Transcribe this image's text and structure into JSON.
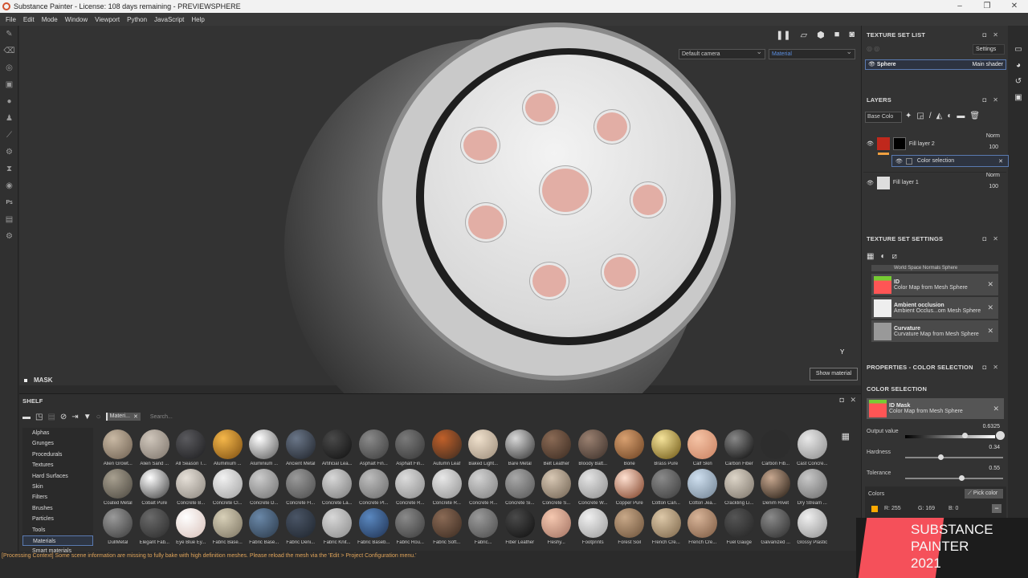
{
  "window": {
    "title": "Substance Painter - License: 108 days remaining - PREVIEWSPHERE",
    "controls": [
      "–",
      "❐",
      "✕"
    ]
  },
  "menu": [
    "File",
    "Edit",
    "Mode",
    "Window",
    "Viewport",
    "Python",
    "JavaScript",
    "Help"
  ],
  "left_tools": [
    "paint-brush",
    "eraser",
    "projection",
    "geometry-decal",
    "smudge",
    "clone-stamp",
    "color-picker",
    "settings",
    "bake",
    "material",
    "photoshop-export",
    "export",
    "plugin"
  ],
  "viewport": {
    "camera_select": "Default camera",
    "mode_select": "Material",
    "show_material_label": "Show material",
    "axis_label": "Y",
    "mask_label": "MASK"
  },
  "shelf": {
    "title": "SHELF",
    "filter_chip": "Materi...",
    "search_placeholder": "Search...",
    "categories": [
      "Alphas",
      "Grunges",
      "Procedurals",
      "Textures",
      "Hard Surfaces",
      "Skin",
      "Filters",
      "Brushes",
      "Particles",
      "Tools",
      "Materials",
      "Smart materials"
    ],
    "active_category": "Materials",
    "materials": [
      {
        "name": "Alien Growt...",
        "c1": "#c9b9a4",
        "c2": "#6d5f50"
      },
      {
        "name": "Alien Sand ...",
        "c1": "#cfc6bb",
        "c2": "#7c736a"
      },
      {
        "name": "All Season T...",
        "c1": "#5a5a5e",
        "c2": "#1c1c1e"
      },
      {
        "name": "Aluminium ...",
        "c1": "#f5b74a",
        "c2": "#7a4c10"
      },
      {
        "name": "Aluminium ...",
        "c1": "#ffffff",
        "c2": "#555555"
      },
      {
        "name": "Ancient Metal",
        "c1": "#6a7688",
        "c2": "#1e2229"
      },
      {
        "name": "Artificial Lea...",
        "c1": "#4a4a4a",
        "c2": "#0f0f0f"
      },
      {
        "name": "Asphalt Fin...",
        "c1": "#8a8a8a",
        "c2": "#3b3b3b"
      },
      {
        "name": "Asphalt Fin...",
        "c1": "#7a7a7a",
        "c2": "#353535"
      },
      {
        "name": "Autumn Leaf",
        "c1": "#c0602a",
        "c2": "#3a2a20"
      },
      {
        "name": "Baked Light...",
        "c1": "#efe0cc",
        "c2": "#9a8a78"
      },
      {
        "name": "Bare Metal",
        "c1": "#d8d8d8",
        "c2": "#303030"
      },
      {
        "name": "Belt Leather",
        "c1": "#8a6a55",
        "c2": "#3a2a20"
      },
      {
        "name": "Bloody Batt...",
        "c1": "#9a8070",
        "c2": "#3a2e28"
      },
      {
        "name": "Bone",
        "c1": "#d8a070",
        "c2": "#6a4020"
      },
      {
        "name": "Brass Pure",
        "c1": "#f5e39a",
        "c2": "#6a5310"
      },
      {
        "name": "Calf Skin",
        "c1": "#f5c3a5",
        "c2": "#c88060"
      },
      {
        "name": "Carbon Fiber",
        "c1": "#888",
        "c2": "#080808"
      },
      {
        "name": "Carbon Fib...",
        "c1": "#2d2d2d",
        "c2": "#2d2d2d"
      },
      {
        "name": "Cast Concre...",
        "c1": "#e8e8e8",
        "c2": "#8a8a8a"
      },
      {
        "name": "Coated Metal",
        "c1": "#a8a090",
        "c2": "#4a463e"
      },
      {
        "name": "Cobalt Pure",
        "c1": "#ffffff",
        "c2": "#3a3a3a"
      },
      {
        "name": "Concrete B...",
        "c1": "#e6e0d8",
        "c2": "#8a847c"
      },
      {
        "name": "Concrete Cl...",
        "c1": "#f2f2f2",
        "c2": "#a0a0a0"
      },
      {
        "name": "Concrete D...",
        "c1": "#cccccc",
        "c2": "#707070"
      },
      {
        "name": "Concrete Fl...",
        "c1": "#9a9a9a",
        "c2": "#4a4a4a"
      },
      {
        "name": "Concrete La...",
        "c1": "#d8d8d8",
        "c2": "#7a7a7a"
      },
      {
        "name": "Concrete Pl...",
        "c1": "#bdbdbd",
        "c2": "#6a6a6a"
      },
      {
        "name": "Concrete R...",
        "c1": "#dcdcdc",
        "c2": "#8a8a8a"
      },
      {
        "name": "Concrete R...",
        "c1": "#e8e8e8",
        "c2": "#909090"
      },
      {
        "name": "Concrete R...",
        "c1": "#d2d2d2",
        "c2": "#7e7e7e"
      },
      {
        "name": "Concrete Si...",
        "c1": "#a8a8a8",
        "c2": "#545454"
      },
      {
        "name": "Concrete S...",
        "c1": "#d8c8b4",
        "c2": "#6e6050"
      },
      {
        "name": "Concrete W...",
        "c1": "#e4e4e4",
        "c2": "#8c8c8c"
      },
      {
        "name": "Copper Pure",
        "c1": "#ffe0d0",
        "c2": "#7a3a20"
      },
      {
        "name": "Cotton Can...",
        "c1": "#8a8a8a",
        "c2": "#3a3a3a"
      },
      {
        "name": "Cotton Jea...",
        "c1": "#cfe0f0",
        "c2": "#6f8090"
      },
      {
        "name": "Crackling Li...",
        "c1": "#ddd5c8",
        "c2": "#7a7268"
      },
      {
        "name": "Denim Rivet",
        "c1": "#c8a890",
        "c2": "#201810"
      },
      {
        "name": "Dry Stream ...",
        "c1": "#c8c8c8",
        "c2": "#6a6a6a"
      },
      {
        "name": "DullMetal",
        "c1": "#9a9a9a",
        "c2": "#3a3a3a"
      },
      {
        "name": "Elegant Fab...",
        "c1": "#6a6a6a",
        "c2": "#2a2a2a"
      },
      {
        "name": "Eye Blue Ey...",
        "c1": "#ffffff",
        "c2": "#d8c0b8"
      },
      {
        "name": "Fabric Base...",
        "c1": "#d8d0b8",
        "c2": "#7a7260"
      },
      {
        "name": "Fabric Base...",
        "c1": "#6a88a8",
        "c2": "#2a3848"
      },
      {
        "name": "Fabric Deni...",
        "c1": "#4a5566",
        "c2": "#1e242c"
      },
      {
        "name": "Fabric Knit...",
        "c1": "#d8d8d8",
        "c2": "#8a8a8a"
      },
      {
        "name": "Fabric Baseb...",
        "c1": "#5a88c0",
        "c2": "#1e3050"
      },
      {
        "name": "Fabric Rou...",
        "c1": "#8a8a8a",
        "c2": "#3a3a3a"
      },
      {
        "name": "Fabric Soft...",
        "c1": "#8a6a55",
        "c2": "#3a2a20"
      },
      {
        "name": "Fabric...",
        "c1": "#9a9a9a",
        "c2": "#4a4a4a"
      },
      {
        "name": "Fiber Leather",
        "c1": "#4a4a4a",
        "c2": "#0e0e0e"
      },
      {
        "name": "Fleshy...",
        "c1": "#f5c8b0",
        "c2": "#a07060"
      },
      {
        "name": "Footprints",
        "c1": "#f0f0f0",
        "c2": "#9a9a9a"
      },
      {
        "name": "Forest Soil",
        "c1": "#c8a888",
        "c2": "#6a5038"
      },
      {
        "name": "French Cre...",
        "c1": "#ddc8a8",
        "c2": "#7a6448"
      },
      {
        "name": "French Cre...",
        "c1": "#d8b498",
        "c2": "#7a5840"
      },
      {
        "name": "Fuel Gauge",
        "c1": "#555",
        "c2": "#222"
      },
      {
        "name": "Galvanized ...",
        "c1": "#8a8a8a",
        "c2": "#2a2a2a"
      },
      {
        "name": "Glossy Plastic",
        "c1": "#f0f0f0",
        "c2": "#909090"
      }
    ]
  },
  "status_message": "[Processing Context] Some scene information are missing to fully bake with high definition meshes. Please reload the mesh via the 'Edit > Project Configuration menu.'",
  "texture_set_list": {
    "title": "TEXTURE SET LIST",
    "settings_label": "Settings",
    "items": [
      {
        "name": "Sphere",
        "shader": "Main shader"
      }
    ]
  },
  "layers": {
    "title": "LAYERS",
    "channel_select": "Base Colo",
    "items": [
      {
        "name": "Fill layer 2",
        "blend": "Norm",
        "opacity": "100"
      },
      {
        "name": "Color selection",
        "type": "mask-effect"
      },
      {
        "name": "Fill layer 1",
        "blend": "Norm",
        "opacity": "100"
      }
    ]
  },
  "texture_set_settings": {
    "title": "TEXTURE SET SETTINGS",
    "partial_item": "World Space Normals Sphere",
    "items": [
      {
        "title": "ID",
        "subtitle": "Color Map from Mesh Sphere"
      },
      {
        "title": "Ambient occlusion",
        "subtitle": "Ambient Occlus...om Mesh Sphere"
      },
      {
        "title": "Curvature",
        "subtitle": "Curvature Map from Mesh Sphere"
      }
    ]
  },
  "properties": {
    "title": "PROPERTIES - COLOR SELECTION",
    "section": "COLOR SELECTION",
    "id_mask": {
      "title": "ID Mask",
      "subtitle": "Color Map from Mesh Sphere"
    },
    "output_value": {
      "label": "Output value",
      "value": "0.6325",
      "fraction": 0.6325
    },
    "hardness": {
      "label": "Hardness",
      "value": "0.34",
      "fraction": 0.34
    },
    "tolerance": {
      "label": "Tolerance",
      "value": "0.55",
      "fraction": 0.55
    },
    "colors_label": "Colors",
    "pick_color_label": "Pick color",
    "color": {
      "r": "R: 255",
      "g": "G: 169",
      "b": "B: 0",
      "hex": "#ffa900"
    }
  },
  "banner": {
    "line1": "SUBSTANCE",
    "line2": "PAINTER",
    "line3": "2021"
  }
}
